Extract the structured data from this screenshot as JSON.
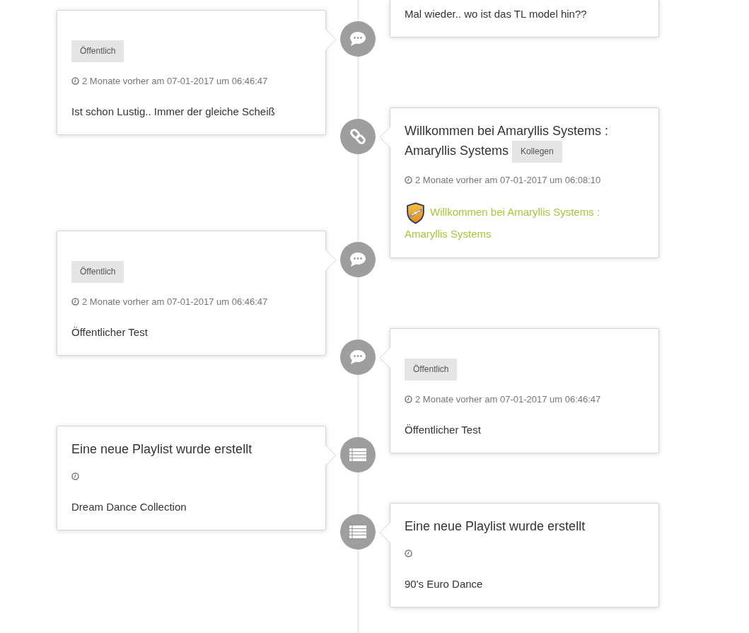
{
  "timeline": {
    "items": [
      {
        "text": "Mal wieder.. wo ist das TL model hin??"
      },
      {
        "kind": "status",
        "badge": "Öffentlich",
        "time": "2 Monate vorher am 07-01-2017 um 06:46:47",
        "text": "Ist schon Lustig.. Immer der gleiche Scheiß"
      },
      {
        "kind": "link",
        "title": "Willkommen bei Amaryllis Systems : Amaryllis Systems",
        "badge": "Kollegen",
        "time": "2 Monate vorher am 07-01-2017 um 06:08:10",
        "link": "Willkommen bei Amaryllis Systems : Amaryllis Systems"
      },
      {
        "kind": "status",
        "badge": "Öffentlich",
        "time": "2 Monate vorher am 07-01-2017 um 06:46:47",
        "text": "Öffentlicher Test"
      },
      {
        "kind": "status",
        "badge": "Öffentlich",
        "time": "2 Monate vorher am 07-01-2017 um 06:46:47",
        "text": "Öffentlicher Test"
      },
      {
        "kind": "playlist",
        "title": "Eine neue Playlist wurde erstellt",
        "text": "Dream Dance Collection"
      },
      {
        "kind": "playlist",
        "title": "Eine neue Playlist wurde erstellt",
        "text": "90's Euro Dance"
      }
    ]
  }
}
